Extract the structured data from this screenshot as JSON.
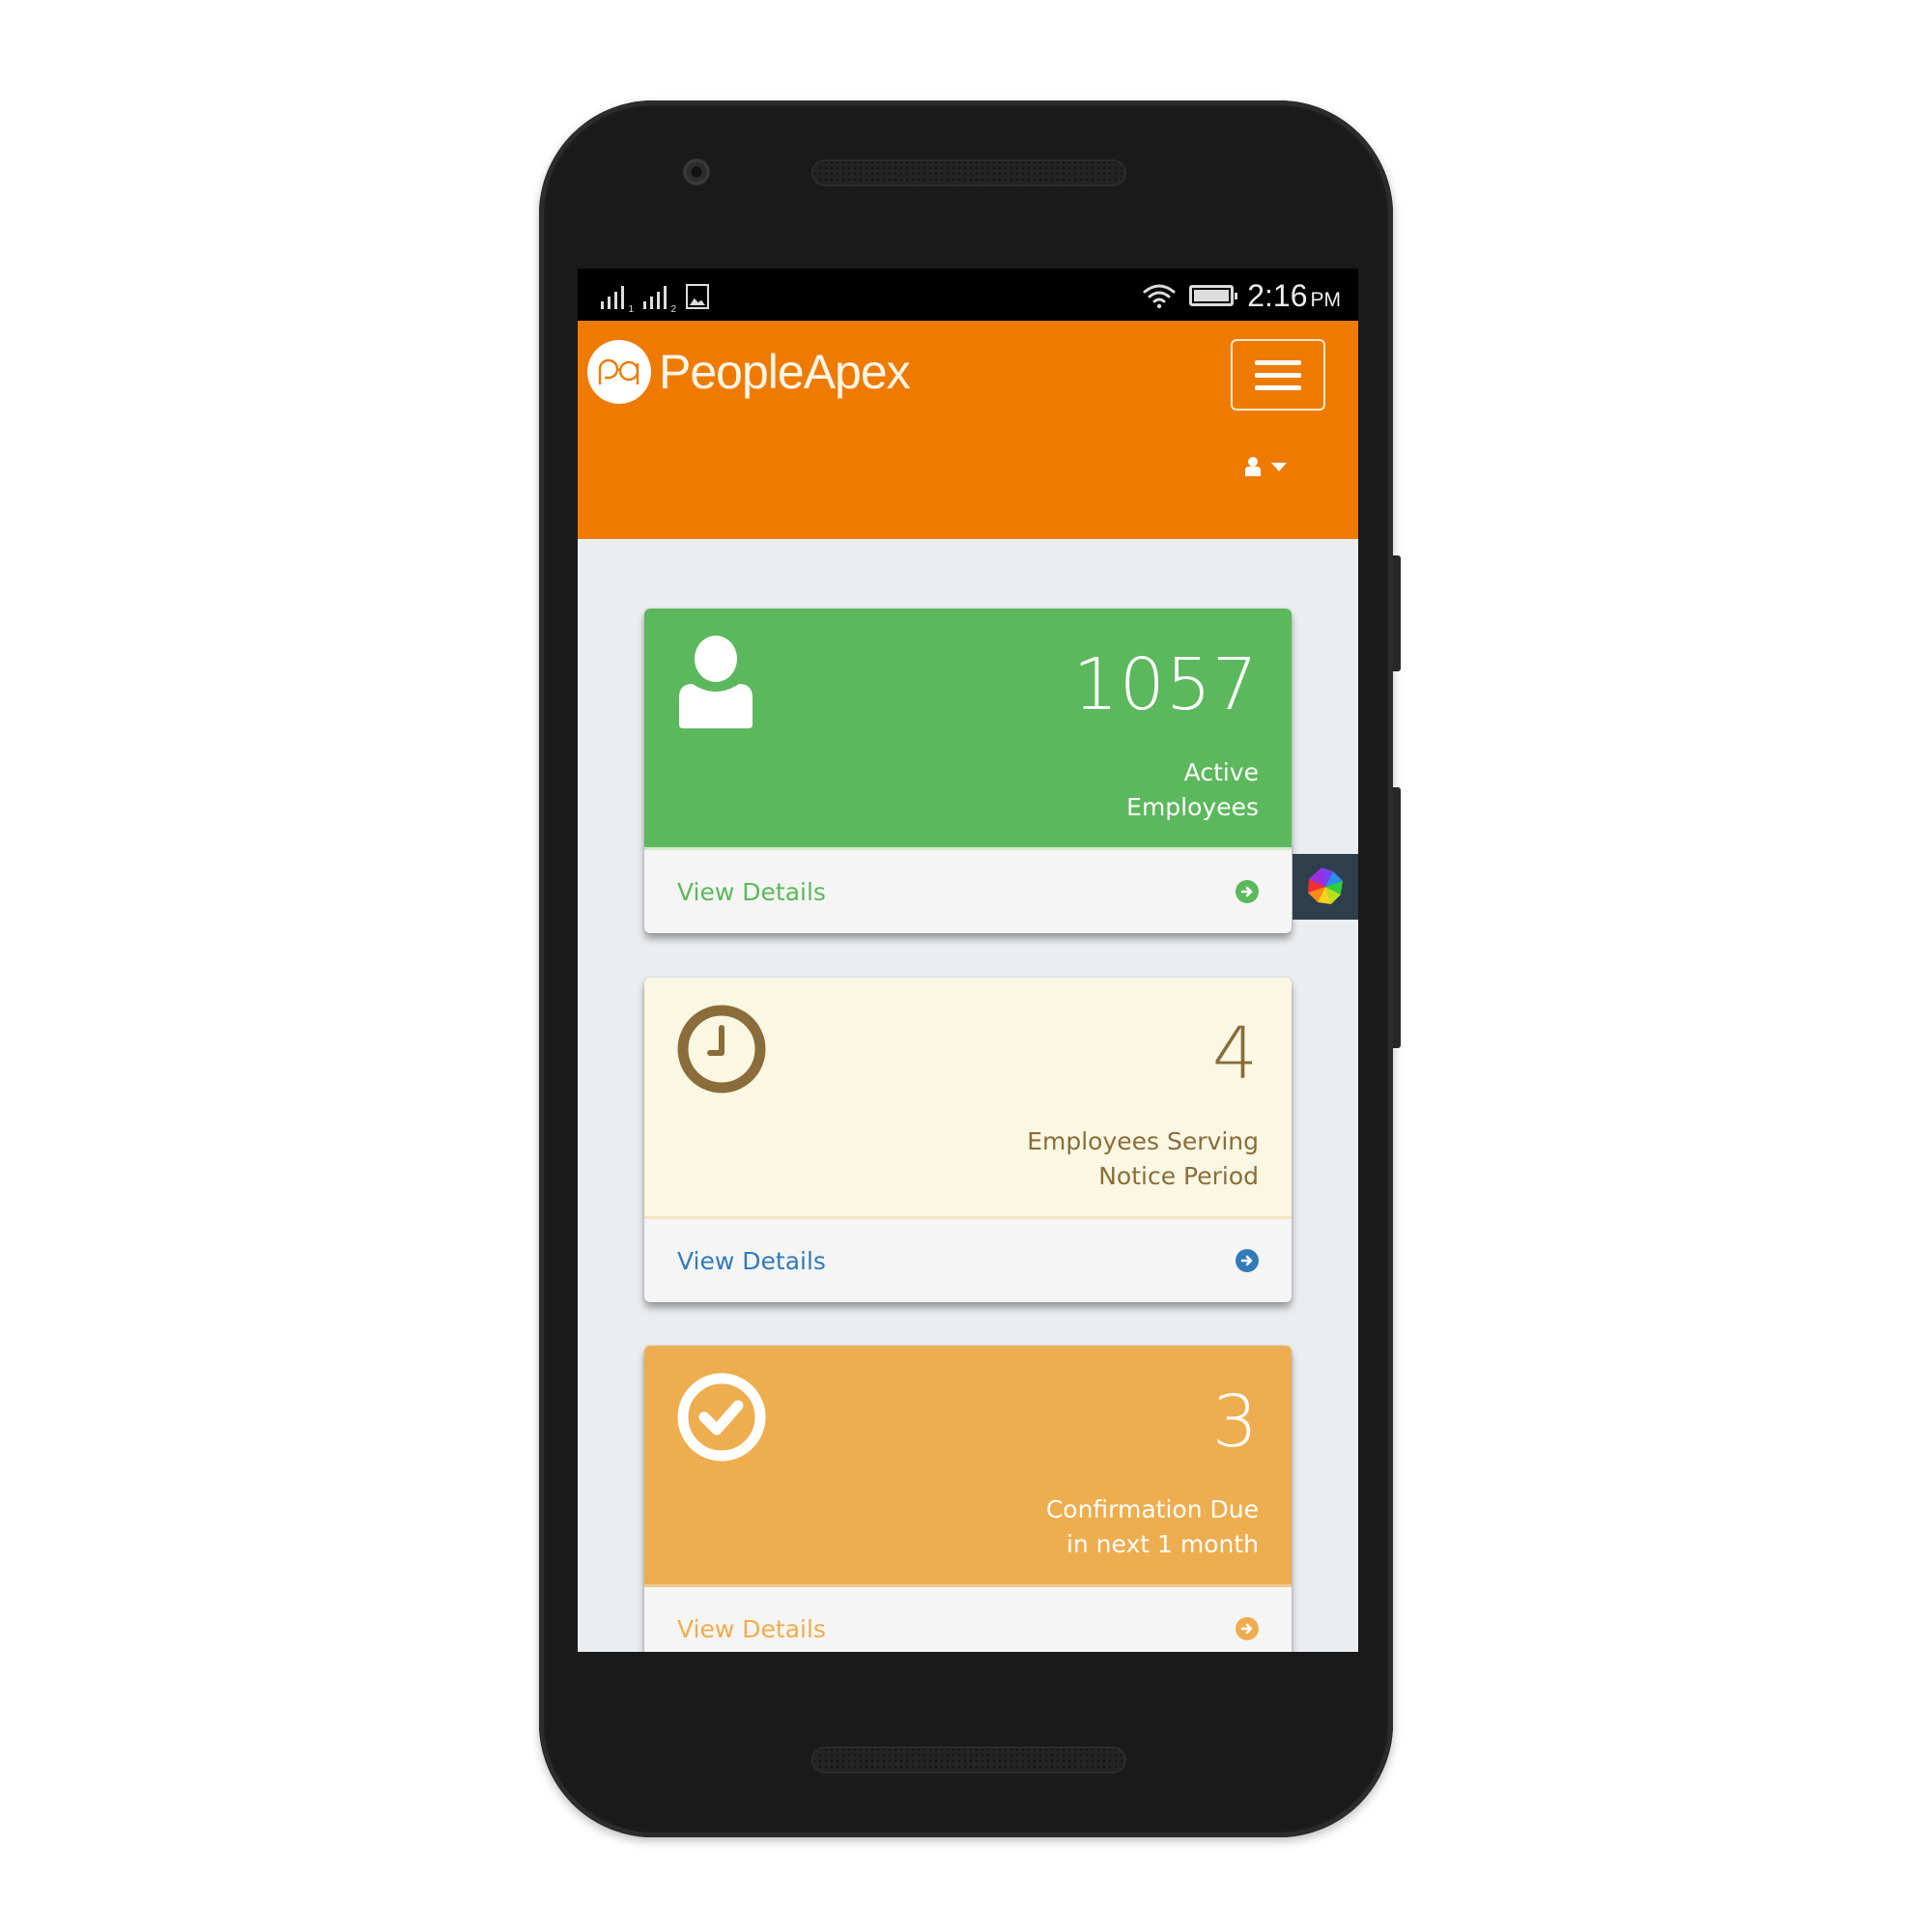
{
  "status_bar": {
    "sim1_label": "1",
    "sim2_label": "2",
    "time": "2:16",
    "ampm": "PM",
    "icons": [
      "signal-sim1-icon",
      "signal-sim2-icon",
      "gallery-notification-icon",
      "wifi-icon",
      "battery-icon"
    ]
  },
  "header": {
    "brand_name": "PeopleApex",
    "logo_text": "pa",
    "menu_button_icon": "hamburger-icon",
    "user_menu_icon": "user-icon",
    "user_menu_caret": "caret-down-icon",
    "brand_color": "#EE7B00"
  },
  "floating_widget": {
    "icon": "colorful-pinwheel-icon"
  },
  "cards": [
    {
      "count": "1057",
      "label_line1": "Active",
      "label_line2": "Employees",
      "icon": "user-icon",
      "link_label": "View Details",
      "link_icon": "arrow-circle-right-icon",
      "color": "#5CB85C"
    },
    {
      "count": "4",
      "label_line1": "Employees Serving",
      "label_line2": "Notice Period",
      "icon": "clock-icon",
      "link_label": "View Details",
      "link_icon": "arrow-circle-right-icon",
      "color": "#8A6D3B"
    },
    {
      "count": "3",
      "label_line1": "Confirmation Due",
      "label_line2": "in next 1 month",
      "icon": "check-circle-icon",
      "link_label": "View Details",
      "link_icon": "arrow-circle-right-icon",
      "color": "#EEAD4E"
    }
  ]
}
